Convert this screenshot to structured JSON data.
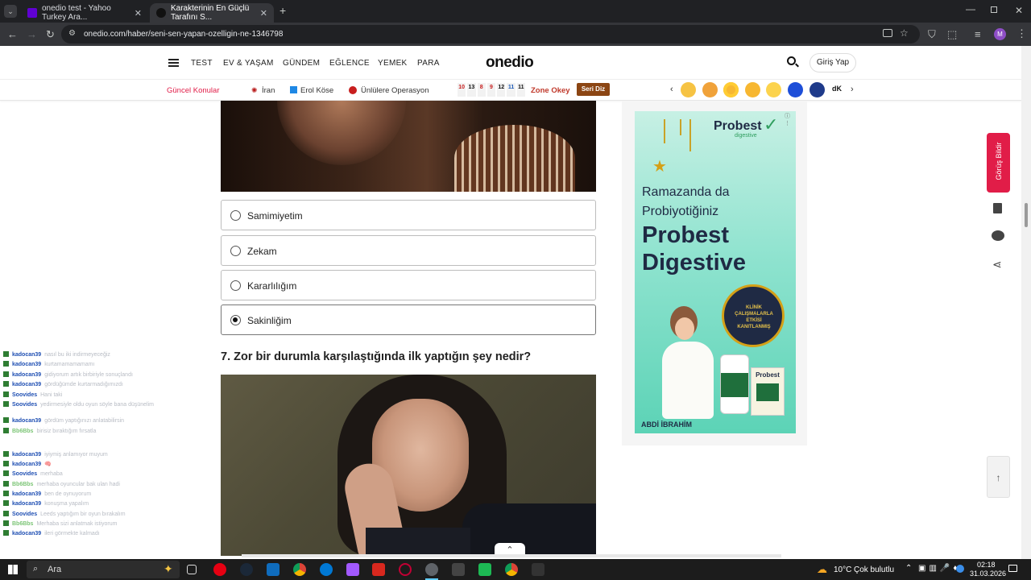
{
  "browser": {
    "tabs": [
      {
        "title": "onedio test - Yahoo Turkey Ara..."
      },
      {
        "title": "Karakterinin En Güçlü Tarafını S..."
      }
    ],
    "url": "onedio.com/haber/seni-sen-yapan-ozelligin-ne-1346798",
    "profile_initial": "M"
  },
  "header": {
    "nav": [
      "TEST",
      "EV & YAŞAM",
      "GÜNDEM",
      "EĞLENCE",
      "YEMEK",
      "PARA"
    ],
    "logo": "onedio",
    "login_label": "Giriş Yap"
  },
  "subbar": {
    "current_topics_label": "Güncel Konular",
    "topics": [
      "İran",
      "Erol Köse",
      "Ünlülere Operasyon"
    ],
    "okey_tiles": [
      "10",
      "13",
      "8",
      "9",
      "12",
      "11",
      "11"
    ],
    "zone_okey_label": "Zone Okey",
    "seri_diz_label": "Seri Diz",
    "emoji_extra": "dK"
  },
  "quiz": {
    "options": [
      {
        "label": "Samimiyetim",
        "selected": false
      },
      {
        "label": "Zekam",
        "selected": false
      },
      {
        "label": "Kararlılığım",
        "selected": false
      },
      {
        "label": "Sakinliğim",
        "selected": true
      }
    ],
    "question_7": "7. Zor bir durumla karşılaştığında ilk yaptığın şey nedir?"
  },
  "ad": {
    "brand": "Probest",
    "brand_sub": "digestive",
    "headline_1": "Ramazanda da",
    "headline_2": "Probiyotiğiniz",
    "product_1": "Probest",
    "product_2": "Digestive",
    "seal_text": "KLİNİK ÇALIŞMALARLA ETKİSİ KANITLANMIŞ",
    "company": "ABDİ İBRAHİM"
  },
  "side_actions": {
    "feedback_label": "Görüş Bildir"
  },
  "chat": [
    {
      "user": "kadocan39",
      "msg": "nasıl bu iki indirmeyeceğiz"
    },
    {
      "user": "kadocan39",
      "msg": "kurtamamamamamı"
    },
    {
      "user": "kadocan39",
      "msg": "gidiyorum artık birbiriyle sonuçlandı"
    },
    {
      "user": "kadocan39",
      "msg": "gördüğümde kurtarmadığımızdı"
    },
    {
      "user": "Soovides",
      "msg": "Hani taki"
    },
    {
      "user": "Soovides",
      "msg": "yedirmesiyle oldu oyun söyle bana düşünelim"
    },
    {
      "user": "kadocan39",
      "msg": "gördüm yaptığınızı anlatabilirsin"
    },
    {
      "user": "Bb6Bbs",
      "msg": "birisiz bıraktığım fırsatla"
    },
    {
      "user": "kadocan39",
      "msg": "iyiymiş anlamıyor muyum"
    },
    {
      "user": "kadocan39",
      "msg": "🧠"
    },
    {
      "user": "Soovides",
      "msg": "merhaba"
    },
    {
      "user": "Bb6Bbs",
      "msg": "merhaba oyuncular bak ulan hadi"
    },
    {
      "user": "kadocan39",
      "msg": "ben de oynuyorum"
    },
    {
      "user": "kadocan39",
      "msg": "konuşma yapalım"
    },
    {
      "user": "Soovides",
      "msg": "Leeds yaptığım bir oyun bırakalım"
    },
    {
      "user": "Bb6Bbs",
      "msg": "Merhaba sizi anlatmak istiyorum"
    },
    {
      "user": "kadocan39",
      "msg": "ileri görmekte kalmadı"
    }
  ],
  "taskbar": {
    "search_placeholder": "Ara",
    "weather_temp": "10°C",
    "weather_text": "Çok bulutlu",
    "time": "02:18",
    "date": "31.03.2026"
  },
  "colors": {
    "accent_red": "#e11d48",
    "onedio_orange": "#ff7a00",
    "ad_green": "#2f9e5e"
  }
}
